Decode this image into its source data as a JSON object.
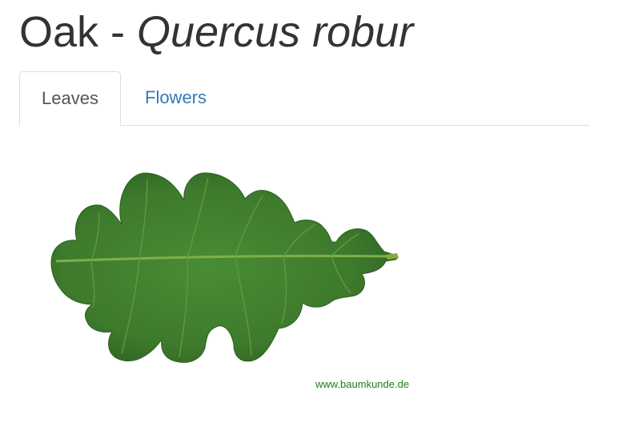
{
  "header": {
    "common_name": "Oak",
    "separator": " - ",
    "species": "Quercus robur"
  },
  "tabs": [
    {
      "label": "Leaves",
      "active": true
    },
    {
      "label": "Flowers",
      "active": false
    }
  ],
  "image": {
    "watermark": "www.baumkunde.de",
    "leaf_color": "#3f7f2e"
  },
  "colors": {
    "link": "#337ab7",
    "text": "#333333",
    "border": "#dddddd"
  }
}
